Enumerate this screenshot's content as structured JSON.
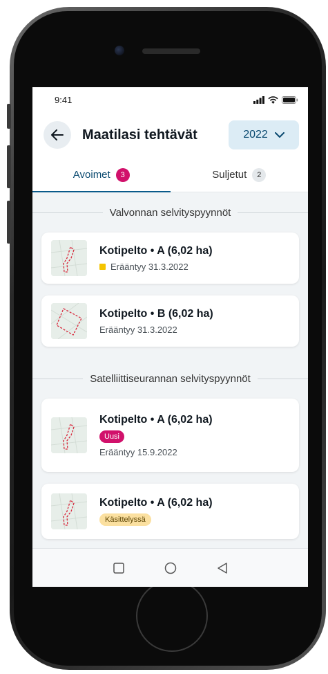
{
  "status_bar": {
    "time": "9:41"
  },
  "header": {
    "title": "Maatilasi tehtävät",
    "year": "2022"
  },
  "tabs": [
    {
      "label": "Avoimet",
      "count": "3"
    },
    {
      "label": "Suljetut",
      "count": "2"
    }
  ],
  "sections": [
    {
      "title": "Valvonnan selvityspyynnöt",
      "cards": [
        {
          "title": "Kotipelto • A (6,02 ha)",
          "due": "Erääntyy 31.3.2022"
        },
        {
          "title": "Kotipelto • B (6,02 ha)",
          "due": "Erääntyy 31.3.2022"
        }
      ]
    },
    {
      "title": "Satelliittiseurannan selvityspyynnöt",
      "cards": [
        {
          "title": "Kotipelto • A (6,02 ha)",
          "tag": "Uusi",
          "due": "Erääntyy 15.9.2022"
        },
        {
          "title": "Kotipelto • A (6,02 ha)",
          "tag": "Käsittelyssä"
        }
      ]
    }
  ],
  "colors": {
    "accent": "#0a5a8a",
    "badge_pink": "#d1116b",
    "status_yellow": "#f4c400",
    "tag_yellow_bg": "#fbe0a0",
    "background": "#f1f4f6"
  },
  "icons": {
    "back": "arrow-left-icon",
    "dropdown": "chevron-down-icon",
    "signal": "signal-icon",
    "wifi": "wifi-icon",
    "battery": "battery-icon",
    "nav_recents": "square-icon",
    "nav_home": "circle-icon",
    "nav_back": "triangle-back-icon"
  }
}
